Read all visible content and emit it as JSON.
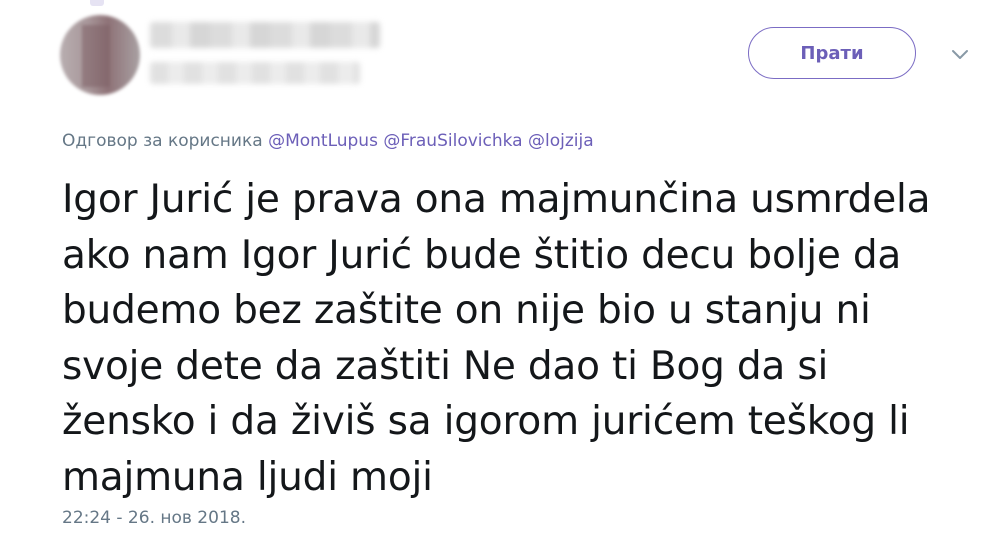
{
  "author": {
    "avatar_icon": "blurred-profile-avatar"
  },
  "follow_button": {
    "label": "Прати"
  },
  "menu": {
    "icon": "chevron-down-icon"
  },
  "reply": {
    "prefix": "Одговор за корисника",
    "mentions": [
      "@MontLupus",
      "@FrauSilovichka",
      "@lojzija"
    ]
  },
  "tweet": {
    "lines": [
      "Igor Jurić je prava ona majmunčina usmrdela",
      "ako nam Igor Jurić bude štitio decu bolje da",
      "budemo bez zaštite on nije bio u stanju ni",
      "svoje dete da zaštiti Ne dao ti Bog da si",
      "žensko i da živiš sa igorom jurićem teškog li",
      "majmuna ljudi moji"
    ],
    "timestamp": "22:24 - 26. нов 2018."
  },
  "colors": {
    "accent": "#6c5fb8",
    "muted": "#657786",
    "text": "#14171a"
  }
}
